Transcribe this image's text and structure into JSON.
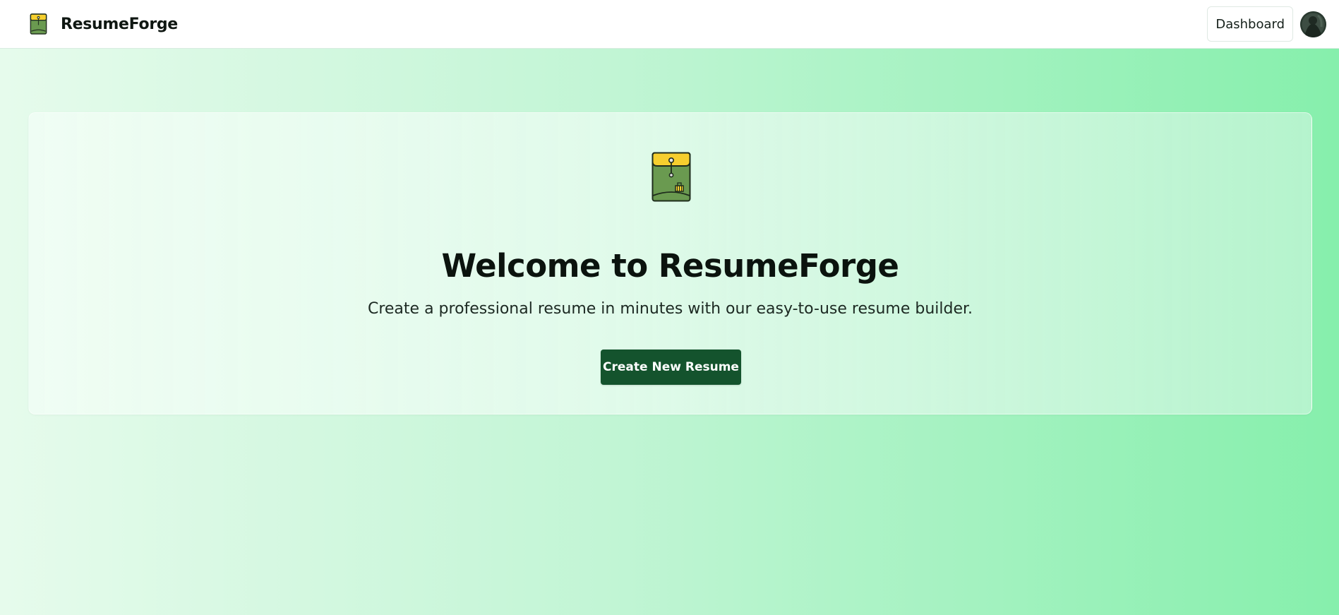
{
  "navbar": {
    "brand_name": "ResumeForge",
    "brand_icon": "folder-icon",
    "dashboard_label": "Dashboard",
    "avatar_icon": "user-avatar"
  },
  "hero": {
    "icon": "folder-icon",
    "title": "Welcome to ResumeForge",
    "subtitle": "Create a professional resume in minutes with our easy-to-use resume builder.",
    "cta_label": "Create New Resume"
  },
  "colors": {
    "primary": "#14532d",
    "folder_green": "#6a9a50",
    "folder_flap": "#f6cf2e",
    "background_start": "#e6fbec",
    "background_end": "#86efac"
  }
}
